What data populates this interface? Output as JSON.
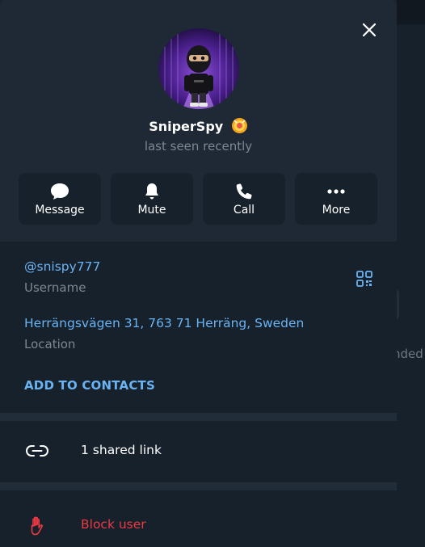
{
  "profile": {
    "name": "SniperSpy",
    "status": "last seen recently"
  },
  "actions": [
    {
      "label": "Message",
      "icon": "message-icon"
    },
    {
      "label": "Mute",
      "icon": "bell-icon"
    },
    {
      "label": "Call",
      "icon": "phone-icon"
    },
    {
      "label": "More",
      "icon": "more-dots-icon"
    }
  ],
  "info": {
    "username": "@snispy777",
    "username_label": "Username",
    "location": "Herrängsvägen 31, 763 71 Herräng, Sweden",
    "location_label": "Location",
    "add_contacts": "ADD TO CONTACTS"
  },
  "shared": {
    "label": "1 shared link"
  },
  "block": {
    "label": "Block user"
  },
  "background": {
    "partial_text": "nded"
  },
  "colors": {
    "accent": "#6ab3f3",
    "danger": "#ec3942",
    "panel": "#17212b",
    "header": "#1f2936"
  }
}
